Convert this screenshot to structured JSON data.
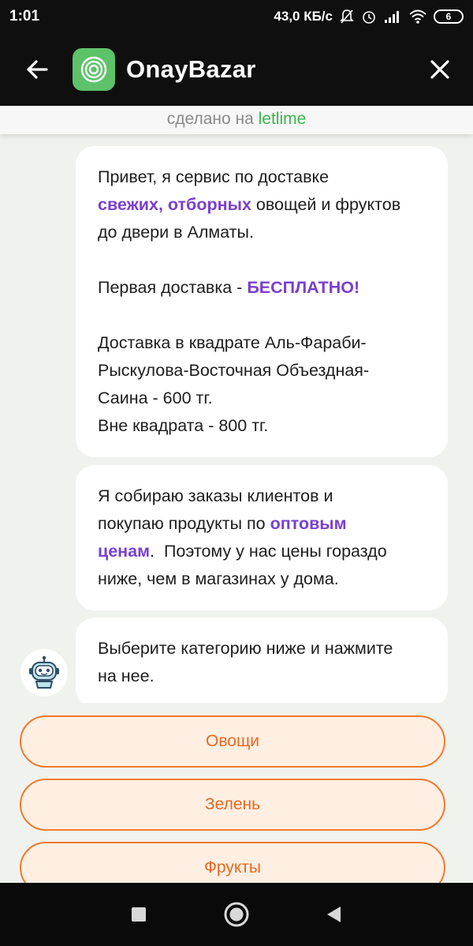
{
  "status_bar": {
    "time": "1:01",
    "network_speed": "43,0 КБ/с",
    "battery": "6"
  },
  "app_bar": {
    "title": "OnayBazar"
  },
  "made_by": {
    "prefix": "сделано на",
    "brand": "letlime"
  },
  "messages": [
    {
      "lines": [
        [
          "Привет, я сервис по доставке"
        ],
        [
          {
            "hl": "свежих, отборных"
          },
          " овощей и фруктов"
        ],
        [
          "до двери в Алматы."
        ],
        [
          ""
        ],
        [
          "Первая доставка - ",
          {
            "hl": "БЕСПЛАТНО!"
          }
        ],
        [
          ""
        ],
        [
          "Доставка в квадрате Аль-Фараби-"
        ],
        [
          "Рыскулова-Восточная Объездная-"
        ],
        [
          "Саина - 600 тг."
        ],
        [
          "Вне квадрата - 800 тг."
        ]
      ]
    },
    {
      "lines": [
        [
          "Я собираю заказы клиентов и"
        ],
        [
          "покупаю продукты по ",
          {
            "hl": "оптовым"
          }
        ],
        [
          {
            "hl": "ценам"
          },
          ".  Поэтому у нас цены гораздо"
        ],
        [
          "ниже, чем в магазинах у дома."
        ]
      ]
    },
    {
      "lines": [
        [
          "Выберите категорию ниже и нажмите"
        ],
        [
          "на нее."
        ]
      ]
    }
  ],
  "choices": [
    {
      "label": "Овощи"
    },
    {
      "label": "Зелень"
    },
    {
      "label": "Фрукты"
    }
  ],
  "colors": {
    "accent": "#7a3fd1",
    "brand_green": "#3bb54a",
    "choice_border": "#f07a2e",
    "choice_bg": "#ffefe3"
  },
  "icons": {
    "back": "arrow-left-icon",
    "close": "close-icon",
    "logo": "onaybazar-logo-icon",
    "avatar": "robot-icon"
  }
}
